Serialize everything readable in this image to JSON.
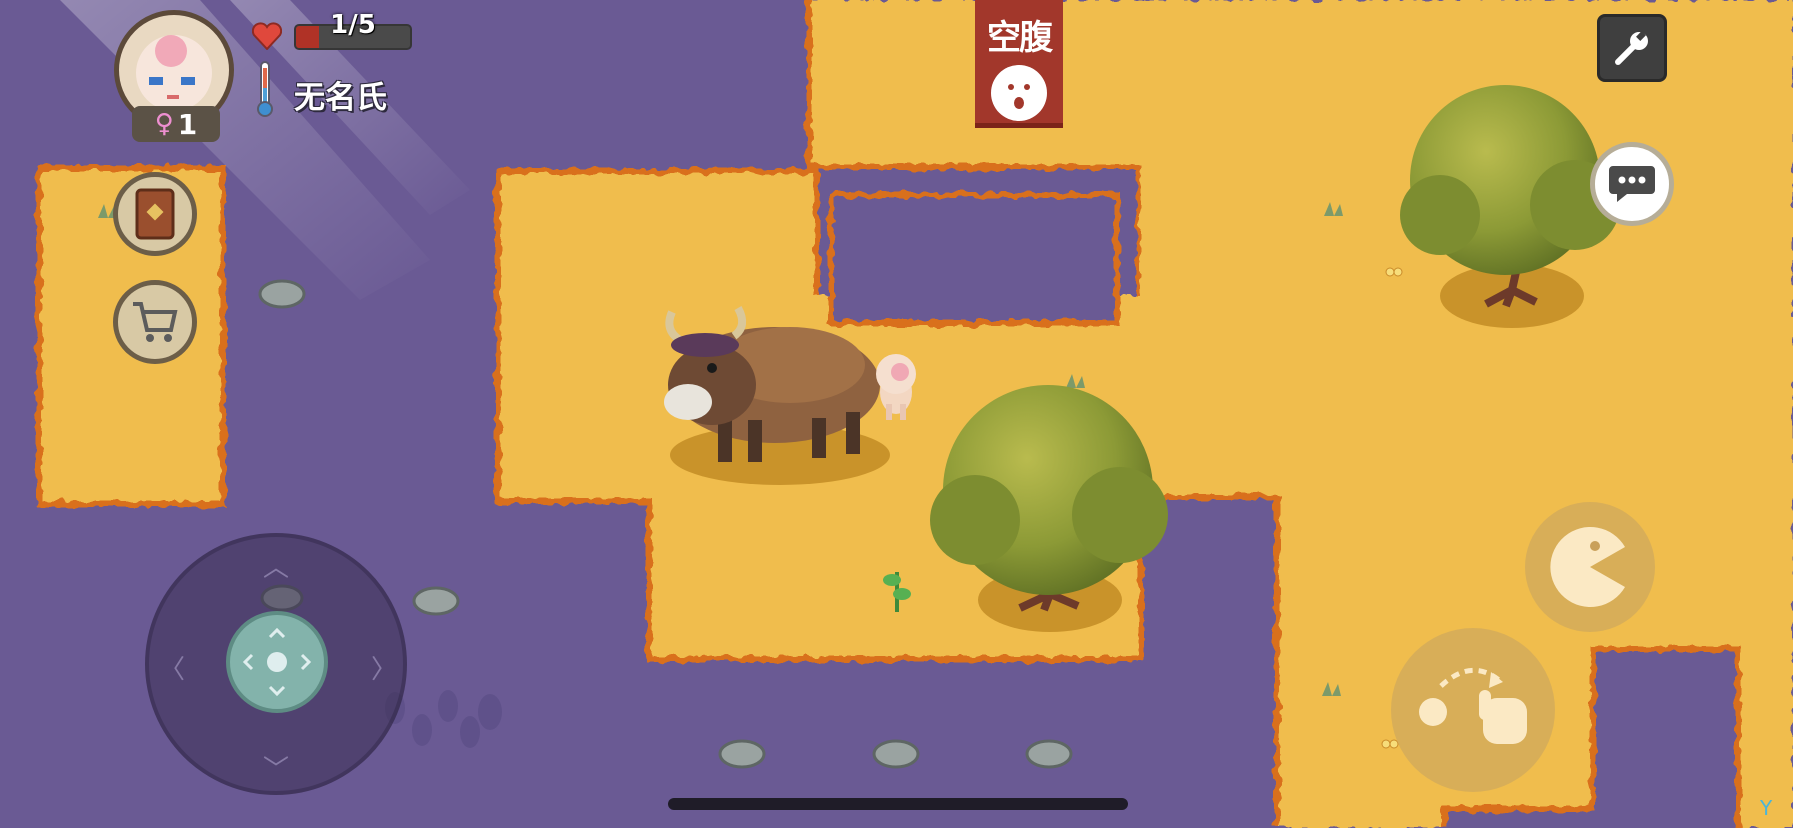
{
  "player": {
    "name": "无名氏",
    "gender_symbol": "♀",
    "age": "1",
    "health_text": "1/5",
    "health_fraction": 0.2
  },
  "status": {
    "hunger_label": "空腹"
  },
  "buttons": {
    "recipe_book_icon": "book-icon",
    "shop_icon": "shopping-cart-icon",
    "settings_icon": "wrench-icon",
    "chat_icon": "speech-bubble-icon",
    "eat_icon": "pacman-mouth-icon",
    "throw_icon": "throw-hand-icon"
  },
  "colors": {
    "water": "#6a5a94",
    "ground": "#f0bd4e",
    "hunger_banner": "#a2372b",
    "health_fill": "#b03226"
  },
  "corner_mark": "Y"
}
